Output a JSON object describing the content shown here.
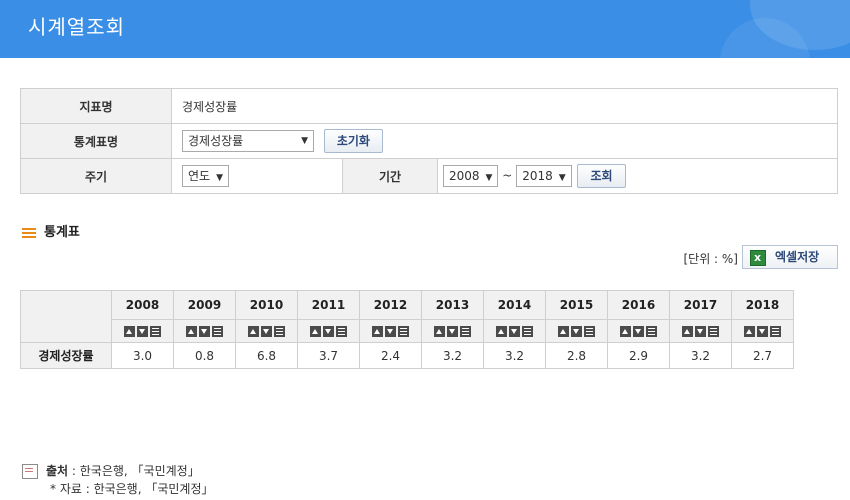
{
  "header": {
    "title": "시계열조회"
  },
  "form": {
    "indicator_label": "지표명",
    "indicator_value": "경제성장률",
    "stat_table_label": "통계표명",
    "stat_table_value": "경제성장률",
    "reset_label": "초기화",
    "cycle_label": "주기",
    "cycle_value": "연도",
    "period_label": "기간",
    "period_from": "2008",
    "period_sep": "~",
    "period_to": "2018",
    "search_label": "조회"
  },
  "section": {
    "title": "통계표"
  },
  "unit": {
    "text": "[단위 : %]"
  },
  "excel": {
    "label": "엑셀저장"
  },
  "table": {
    "years": [
      "2008",
      "2009",
      "2010",
      "2011",
      "2012",
      "2013",
      "2014",
      "2015",
      "2016",
      "2017",
      "2018"
    ],
    "row_label": "경제성장률",
    "values": [
      "3.0",
      "0.8",
      "6.8",
      "3.7",
      "2.4",
      "3.2",
      "3.2",
      "2.8",
      "2.9",
      "3.2",
      "2.7"
    ]
  },
  "source": {
    "label": "출처",
    "text": " : 한국은행, 「국민계정」",
    "note": "* 자료 : 한국은행, 「국민계정」"
  }
}
